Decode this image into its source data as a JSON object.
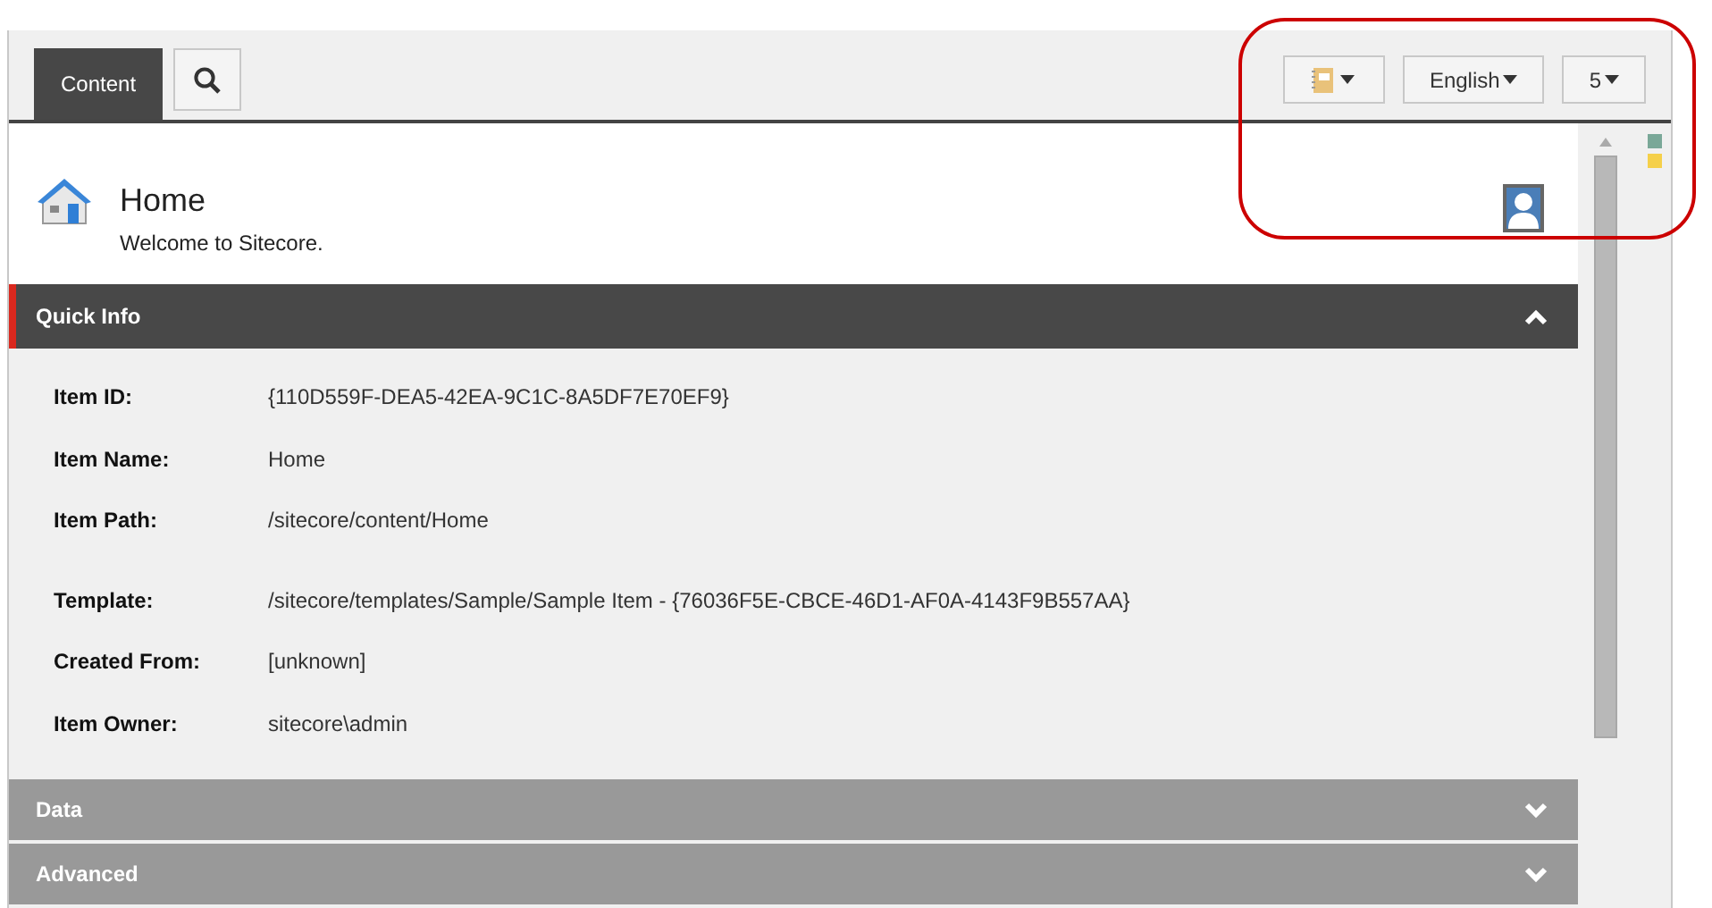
{
  "tabs": [
    {
      "kind": "text",
      "label": "Content",
      "selected": true
    },
    {
      "kind": "search",
      "selected": false
    }
  ],
  "toolbar": [
    {
      "kind": "icon"
    },
    {
      "kind": "text",
      "label": "English"
    },
    {
      "kind": "text",
      "label": "5"
    }
  ],
  "header": {
    "title": "Home",
    "subtitle": "Welcome to Sitecore."
  },
  "sections": [
    {
      "title": "Quick Info",
      "expanded": true,
      "field_groups": [
        {
          "fields": [
            {
              "label": "Item ID:",
              "value": "{110D559F-DEA5-42EA-9C1C-8A5DF7E70EF9}"
            },
            {
              "label": "Item Name:",
              "value": "Home"
            },
            {
              "label": "Item Path:",
              "value": "/sitecore/content/Home"
            }
          ]
        },
        {
          "fields": [
            {
              "label": "Template:",
              "value": "/sitecore/templates/Sample/Sample Item - {76036F5E-CBCE-46D1-AF0A-4143F9B557AA}"
            },
            {
              "label": "Created From:",
              "value": "[unknown]"
            },
            {
              "label": "Item Owner:",
              "value": "sitecore\\admin"
            }
          ]
        }
      ]
    },
    {
      "title": "Data",
      "expanded": false
    },
    {
      "title": "Advanced",
      "expanded": false
    }
  ],
  "markers": [
    {
      "color": "#7aa898"
    },
    {
      "color": "#f5d04a"
    }
  ]
}
